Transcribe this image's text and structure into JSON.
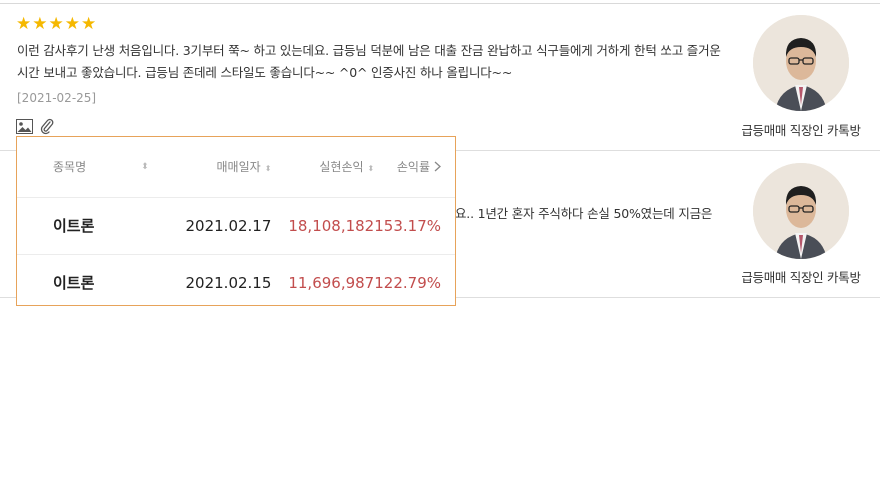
{
  "reviews": [
    {
      "stars": [
        "★",
        "★",
        "★",
        "★",
        "★"
      ],
      "text": "이런 감사후기 난생 처음입니다. 3기부터 쭉~ 하고 있는데요. 급등님 덕분에 남은 대출 잔금 완납하고 식구들에게 거하게 한턱 쏘고 즐거운 시간 보내고 좋았습니다. 급등님 존데레 스타일도 좋습니다~~ ^0^ 인증사진 하나 올립니다~~",
      "date": "[2021-02-25]",
      "author": "급등매매 직장인 카톡방"
    },
    {
      "text_visible": "요.. 1년간 혼자 주식하다 손실 50%였는데 지금은",
      "author": "급등매매 직장인 카톡방"
    }
  ],
  "icons": {
    "image": "image-icon",
    "attachment": "paperclip-icon",
    "sort": "sort-icon",
    "chevron": "chevron-right-icon"
  },
  "trade_table": {
    "headers": {
      "name": "종목명",
      "date": "매매일자",
      "pl": "실현손익",
      "rate": "손익률"
    },
    "sort_glyph": "⬍",
    "rows": [
      {
        "name": "이트론",
        "date": "2021.02.17",
        "pl": "18,108,182",
        "rate": "153.17%"
      },
      {
        "name": "이트론",
        "date": "2021.02.15",
        "pl": "11,696,987",
        "rate": "122.79%"
      }
    ]
  },
  "colors": {
    "star": "#f5b800",
    "profit": "#c24d4d",
    "popup_border": "#e7a35a"
  }
}
